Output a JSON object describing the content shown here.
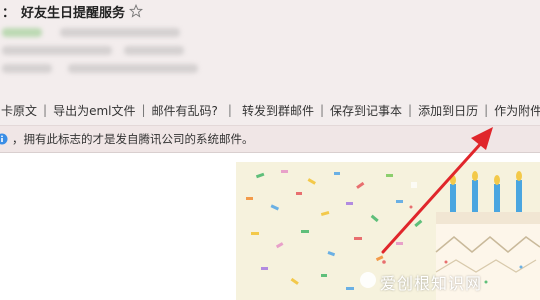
{
  "mail": {
    "colon": "：",
    "subject": "好友生日提醒服务"
  },
  "toolbar": {
    "items": [
      "卡原文",
      "导出为eml文件",
      "邮件有乱码?",
      "转发到群邮件",
      "保存到记事本",
      "添加到日历",
      "作为附件转发"
    ]
  },
  "notice": {
    "text": "，拥有此标志的才是发自腾讯公司的系统邮件。"
  },
  "watermark": {
    "text": "爱创根知识网"
  },
  "icons": {
    "star": "star-outline-icon",
    "info": "info-icon",
    "arrow": "red-arrow"
  },
  "colors": {
    "arrow": "#e0262b",
    "header_bg": "#f3eded",
    "notice_bg": "#f0e6e6"
  }
}
